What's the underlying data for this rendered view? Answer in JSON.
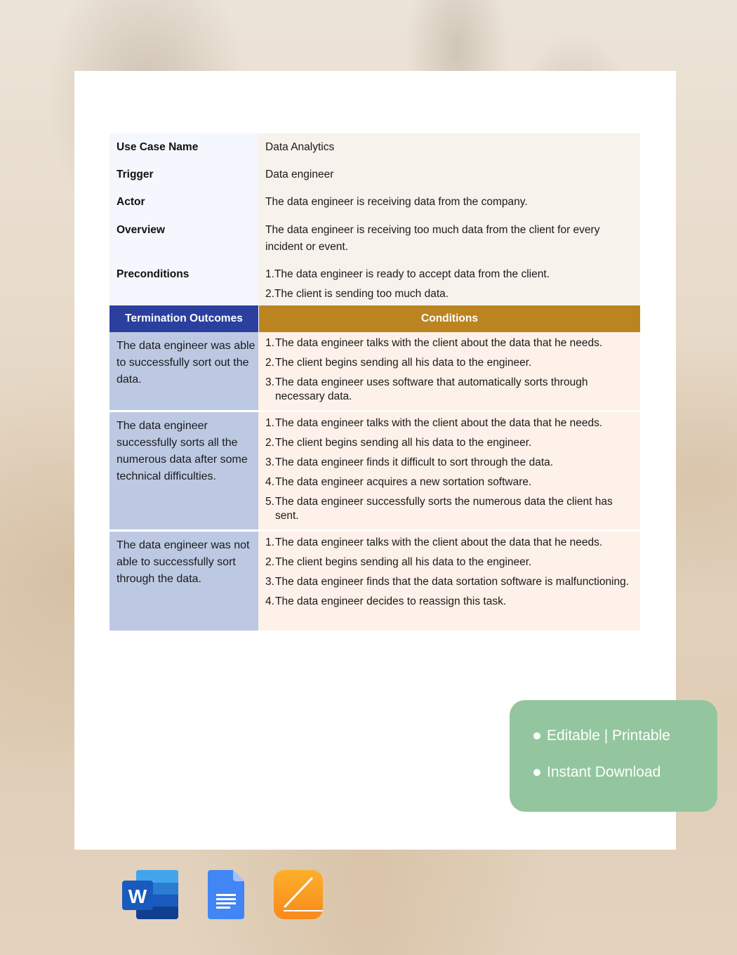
{
  "document": {
    "info_rows": [
      {
        "label": "Use Case Name",
        "value": "Data Analytics"
      },
      {
        "label": "Trigger",
        "value": "Data engineer"
      },
      {
        "label": "Actor",
        "value": "The data engineer is receiving data from the company."
      },
      {
        "label": "Overview",
        "value": "The data engineer is receiving too much data from the client for every incident or event."
      },
      {
        "label": "Preconditions",
        "items": [
          "1.The data engineer is ready to accept data from the client.",
          "2.The client is sending too much data."
        ]
      }
    ],
    "outcomes_header": {
      "left": "Termination Outcomes",
      "right": "Conditions"
    },
    "outcomes": [
      {
        "outcome": "The data engineer was able to successfully sort out the data.",
        "conditions": [
          {
            "num": "1.",
            "text": "The data engineer talks with the client about the data that he needs."
          },
          {
            "num": "2.",
            "text": "The client begins sending all his data to the engineer."
          },
          {
            "num": "3.",
            "text": "The data engineer uses software that automatically sorts through necessary data."
          }
        ]
      },
      {
        "outcome": "The data engineer successfully sorts all the numerous data after some technical difficulties.",
        "conditions": [
          {
            "num": "1.",
            "text": "The data engineer talks with the client about the data that he needs."
          },
          {
            "num": "2.",
            "text": "The client begins sending all his data to the engineer."
          },
          {
            "num": "3.",
            "text": "The data engineer finds it difficult to sort through the data."
          },
          {
            "num": "4.",
            "text": "The data engineer acquires a new sortation software."
          },
          {
            "num": "5.",
            "text": "The data engineer successfully sorts the numerous data the client has sent."
          }
        ]
      },
      {
        "outcome": "The data engineer was not able to successfully sort through the data.",
        "conditions": [
          {
            "num": "1.",
            "text": "The data engineer talks with the client about the data that he needs."
          },
          {
            "num": "2.",
            "text": "The client begins sending all his data to the engineer."
          },
          {
            "num": "3.",
            "text": "The data engineer finds that the data sortation software is malfunctioning."
          },
          {
            "num": "4.",
            "text": "The data engineer decides to reassign this task."
          }
        ]
      }
    ]
  },
  "badge": {
    "items": [
      "Editable | Printable",
      "Instant Download"
    ]
  },
  "app_icons": [
    "word-icon",
    "google-docs-icon",
    "apple-pages-icon"
  ],
  "colors": {
    "header_blue": "#2b3f9e",
    "header_gold": "#bb8420",
    "outcome_blue": "#bdc9e3",
    "condition_peach": "#fdf1e9",
    "badge_green": "#93c69e"
  }
}
